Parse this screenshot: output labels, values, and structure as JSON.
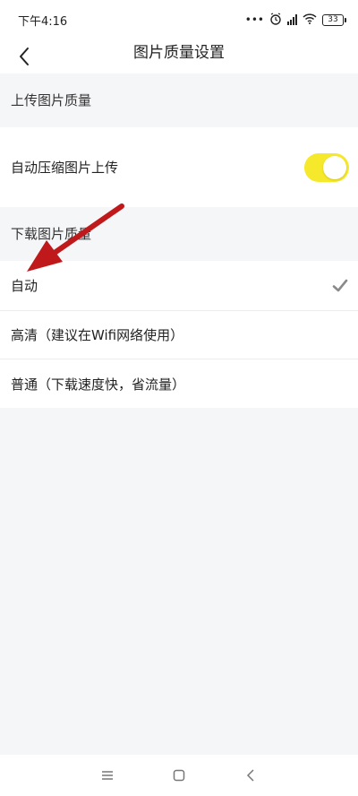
{
  "status_bar": {
    "time": "下午4:16",
    "icons": [
      "more-dots-icon",
      "alarm-icon",
      "hd-signal-icon",
      "wifi-icon",
      "battery-icon"
    ],
    "battery_level": "33"
  },
  "nav": {
    "title": "图片质量设置",
    "back_icon": "chevron-left-icon"
  },
  "upload": {
    "header": "上传图片质量",
    "auto_compress_label": "自动压缩图片上传",
    "auto_compress_enabled": true
  },
  "download": {
    "header": "下载图片质量",
    "options": [
      {
        "label": "自动",
        "selected": true
      },
      {
        "label": "高清（建议在Wifi网络使用）",
        "selected": false
      },
      {
        "label": "普通（下载速度快，省流量）",
        "selected": false
      }
    ]
  },
  "system_nav": {
    "icons": [
      "menu-icon",
      "home-icon",
      "back-icon"
    ]
  },
  "colors": {
    "toggle_on": "#f6e82a",
    "annotation_arrow": "#c0191b",
    "checkmark": "#8a8a8a"
  }
}
